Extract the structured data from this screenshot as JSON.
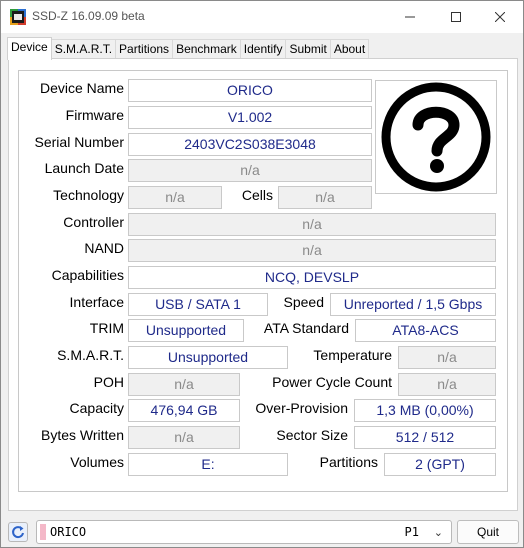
{
  "window": {
    "title": "SSD-Z 16.09.09 beta"
  },
  "tabs": [
    "Device",
    "S.M.A.R.T.",
    "Partitions",
    "Benchmark",
    "Identify",
    "Submit",
    "About"
  ],
  "device": {
    "device_name": {
      "label": "Device Name",
      "value": "ORICO"
    },
    "firmware": {
      "label": "Firmware",
      "value": "V1.002"
    },
    "serial_number": {
      "label": "Serial Number",
      "value": "2403VC2S038E3048"
    },
    "launch_date": {
      "label": "Launch Date",
      "value": "n/a"
    },
    "technology": {
      "label": "Technology",
      "value": "n/a"
    },
    "cells": {
      "label": "Cells",
      "value": "n/a"
    },
    "controller": {
      "label": "Controller",
      "value": "n/a"
    },
    "nand": {
      "label": "NAND",
      "value": "n/a"
    },
    "capabilities": {
      "label": "Capabilities",
      "value": "NCQ, DEVSLP"
    },
    "interface": {
      "label": "Interface",
      "value": "USB / SATA 1"
    },
    "speed": {
      "label": "Speed",
      "value": "Unreported / 1,5 Gbps"
    },
    "trim": {
      "label": "TRIM",
      "value": "Unsupported"
    },
    "ata_standard": {
      "label": "ATA Standard",
      "value": "ATA8-ACS"
    },
    "smart": {
      "label": "S.M.A.R.T.",
      "value": "Unsupported"
    },
    "temperature": {
      "label": "Temperature",
      "value": "n/a"
    },
    "poh": {
      "label": "POH",
      "value": "n/a"
    },
    "power_cycle_count": {
      "label": "Power Cycle Count",
      "value": "n/a"
    },
    "capacity": {
      "label": "Capacity",
      "value": "476,94 GB"
    },
    "over_provision": {
      "label": "Over-Provision",
      "value": "1,3 MB (0,00%)"
    },
    "bytes_written": {
      "label": "Bytes Written",
      "value": "n/a"
    },
    "sector_size": {
      "label": "Sector Size",
      "value": "512 / 512"
    },
    "volumes": {
      "label": "Volumes",
      "value": "E:"
    },
    "partitions": {
      "label": "Partitions",
      "value": "2 (GPT)"
    }
  },
  "device_image": {
    "icon": "question-mark-icon"
  },
  "bottom_bar": {
    "drive_select": {
      "name": "ORICO",
      "partition": "P1"
    },
    "quit_label": "Quit"
  },
  "colors": {
    "value_text": "#1f2a8a",
    "na_text": "#8a8a8a",
    "na_background": "#f0f0f0"
  }
}
